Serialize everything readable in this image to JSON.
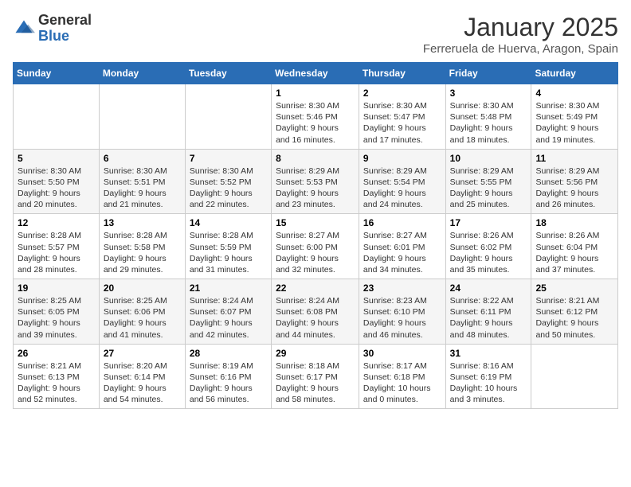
{
  "header": {
    "logo_general": "General",
    "logo_blue": "Blue",
    "title": "January 2025",
    "subtitle": "Ferreruela de Huerva, Aragon, Spain"
  },
  "weekdays": [
    "Sunday",
    "Monday",
    "Tuesday",
    "Wednesday",
    "Thursday",
    "Friday",
    "Saturday"
  ],
  "weeks": [
    [
      {
        "day": "",
        "info": ""
      },
      {
        "day": "",
        "info": ""
      },
      {
        "day": "",
        "info": ""
      },
      {
        "day": "1",
        "info": "Sunrise: 8:30 AM\nSunset: 5:46 PM\nDaylight: 9 hours\nand 16 minutes."
      },
      {
        "day": "2",
        "info": "Sunrise: 8:30 AM\nSunset: 5:47 PM\nDaylight: 9 hours\nand 17 minutes."
      },
      {
        "day": "3",
        "info": "Sunrise: 8:30 AM\nSunset: 5:48 PM\nDaylight: 9 hours\nand 18 minutes."
      },
      {
        "day": "4",
        "info": "Sunrise: 8:30 AM\nSunset: 5:49 PM\nDaylight: 9 hours\nand 19 minutes."
      }
    ],
    [
      {
        "day": "5",
        "info": "Sunrise: 8:30 AM\nSunset: 5:50 PM\nDaylight: 9 hours\nand 20 minutes."
      },
      {
        "day": "6",
        "info": "Sunrise: 8:30 AM\nSunset: 5:51 PM\nDaylight: 9 hours\nand 21 minutes."
      },
      {
        "day": "7",
        "info": "Sunrise: 8:30 AM\nSunset: 5:52 PM\nDaylight: 9 hours\nand 22 minutes."
      },
      {
        "day": "8",
        "info": "Sunrise: 8:29 AM\nSunset: 5:53 PM\nDaylight: 9 hours\nand 23 minutes."
      },
      {
        "day": "9",
        "info": "Sunrise: 8:29 AM\nSunset: 5:54 PM\nDaylight: 9 hours\nand 24 minutes."
      },
      {
        "day": "10",
        "info": "Sunrise: 8:29 AM\nSunset: 5:55 PM\nDaylight: 9 hours\nand 25 minutes."
      },
      {
        "day": "11",
        "info": "Sunrise: 8:29 AM\nSunset: 5:56 PM\nDaylight: 9 hours\nand 26 minutes."
      }
    ],
    [
      {
        "day": "12",
        "info": "Sunrise: 8:28 AM\nSunset: 5:57 PM\nDaylight: 9 hours\nand 28 minutes."
      },
      {
        "day": "13",
        "info": "Sunrise: 8:28 AM\nSunset: 5:58 PM\nDaylight: 9 hours\nand 29 minutes."
      },
      {
        "day": "14",
        "info": "Sunrise: 8:28 AM\nSunset: 5:59 PM\nDaylight: 9 hours\nand 31 minutes."
      },
      {
        "day": "15",
        "info": "Sunrise: 8:27 AM\nSunset: 6:00 PM\nDaylight: 9 hours\nand 32 minutes."
      },
      {
        "day": "16",
        "info": "Sunrise: 8:27 AM\nSunset: 6:01 PM\nDaylight: 9 hours\nand 34 minutes."
      },
      {
        "day": "17",
        "info": "Sunrise: 8:26 AM\nSunset: 6:02 PM\nDaylight: 9 hours\nand 35 minutes."
      },
      {
        "day": "18",
        "info": "Sunrise: 8:26 AM\nSunset: 6:04 PM\nDaylight: 9 hours\nand 37 minutes."
      }
    ],
    [
      {
        "day": "19",
        "info": "Sunrise: 8:25 AM\nSunset: 6:05 PM\nDaylight: 9 hours\nand 39 minutes."
      },
      {
        "day": "20",
        "info": "Sunrise: 8:25 AM\nSunset: 6:06 PM\nDaylight: 9 hours\nand 41 minutes."
      },
      {
        "day": "21",
        "info": "Sunrise: 8:24 AM\nSunset: 6:07 PM\nDaylight: 9 hours\nand 42 minutes."
      },
      {
        "day": "22",
        "info": "Sunrise: 8:24 AM\nSunset: 6:08 PM\nDaylight: 9 hours\nand 44 minutes."
      },
      {
        "day": "23",
        "info": "Sunrise: 8:23 AM\nSunset: 6:10 PM\nDaylight: 9 hours\nand 46 minutes."
      },
      {
        "day": "24",
        "info": "Sunrise: 8:22 AM\nSunset: 6:11 PM\nDaylight: 9 hours\nand 48 minutes."
      },
      {
        "day": "25",
        "info": "Sunrise: 8:21 AM\nSunset: 6:12 PM\nDaylight: 9 hours\nand 50 minutes."
      }
    ],
    [
      {
        "day": "26",
        "info": "Sunrise: 8:21 AM\nSunset: 6:13 PM\nDaylight: 9 hours\nand 52 minutes."
      },
      {
        "day": "27",
        "info": "Sunrise: 8:20 AM\nSunset: 6:14 PM\nDaylight: 9 hours\nand 54 minutes."
      },
      {
        "day": "28",
        "info": "Sunrise: 8:19 AM\nSunset: 6:16 PM\nDaylight: 9 hours\nand 56 minutes."
      },
      {
        "day": "29",
        "info": "Sunrise: 8:18 AM\nSunset: 6:17 PM\nDaylight: 9 hours\nand 58 minutes."
      },
      {
        "day": "30",
        "info": "Sunrise: 8:17 AM\nSunset: 6:18 PM\nDaylight: 10 hours\nand 0 minutes."
      },
      {
        "day": "31",
        "info": "Sunrise: 8:16 AM\nSunset: 6:19 PM\nDaylight: 10 hours\nand 3 minutes."
      },
      {
        "day": "",
        "info": ""
      }
    ]
  ]
}
